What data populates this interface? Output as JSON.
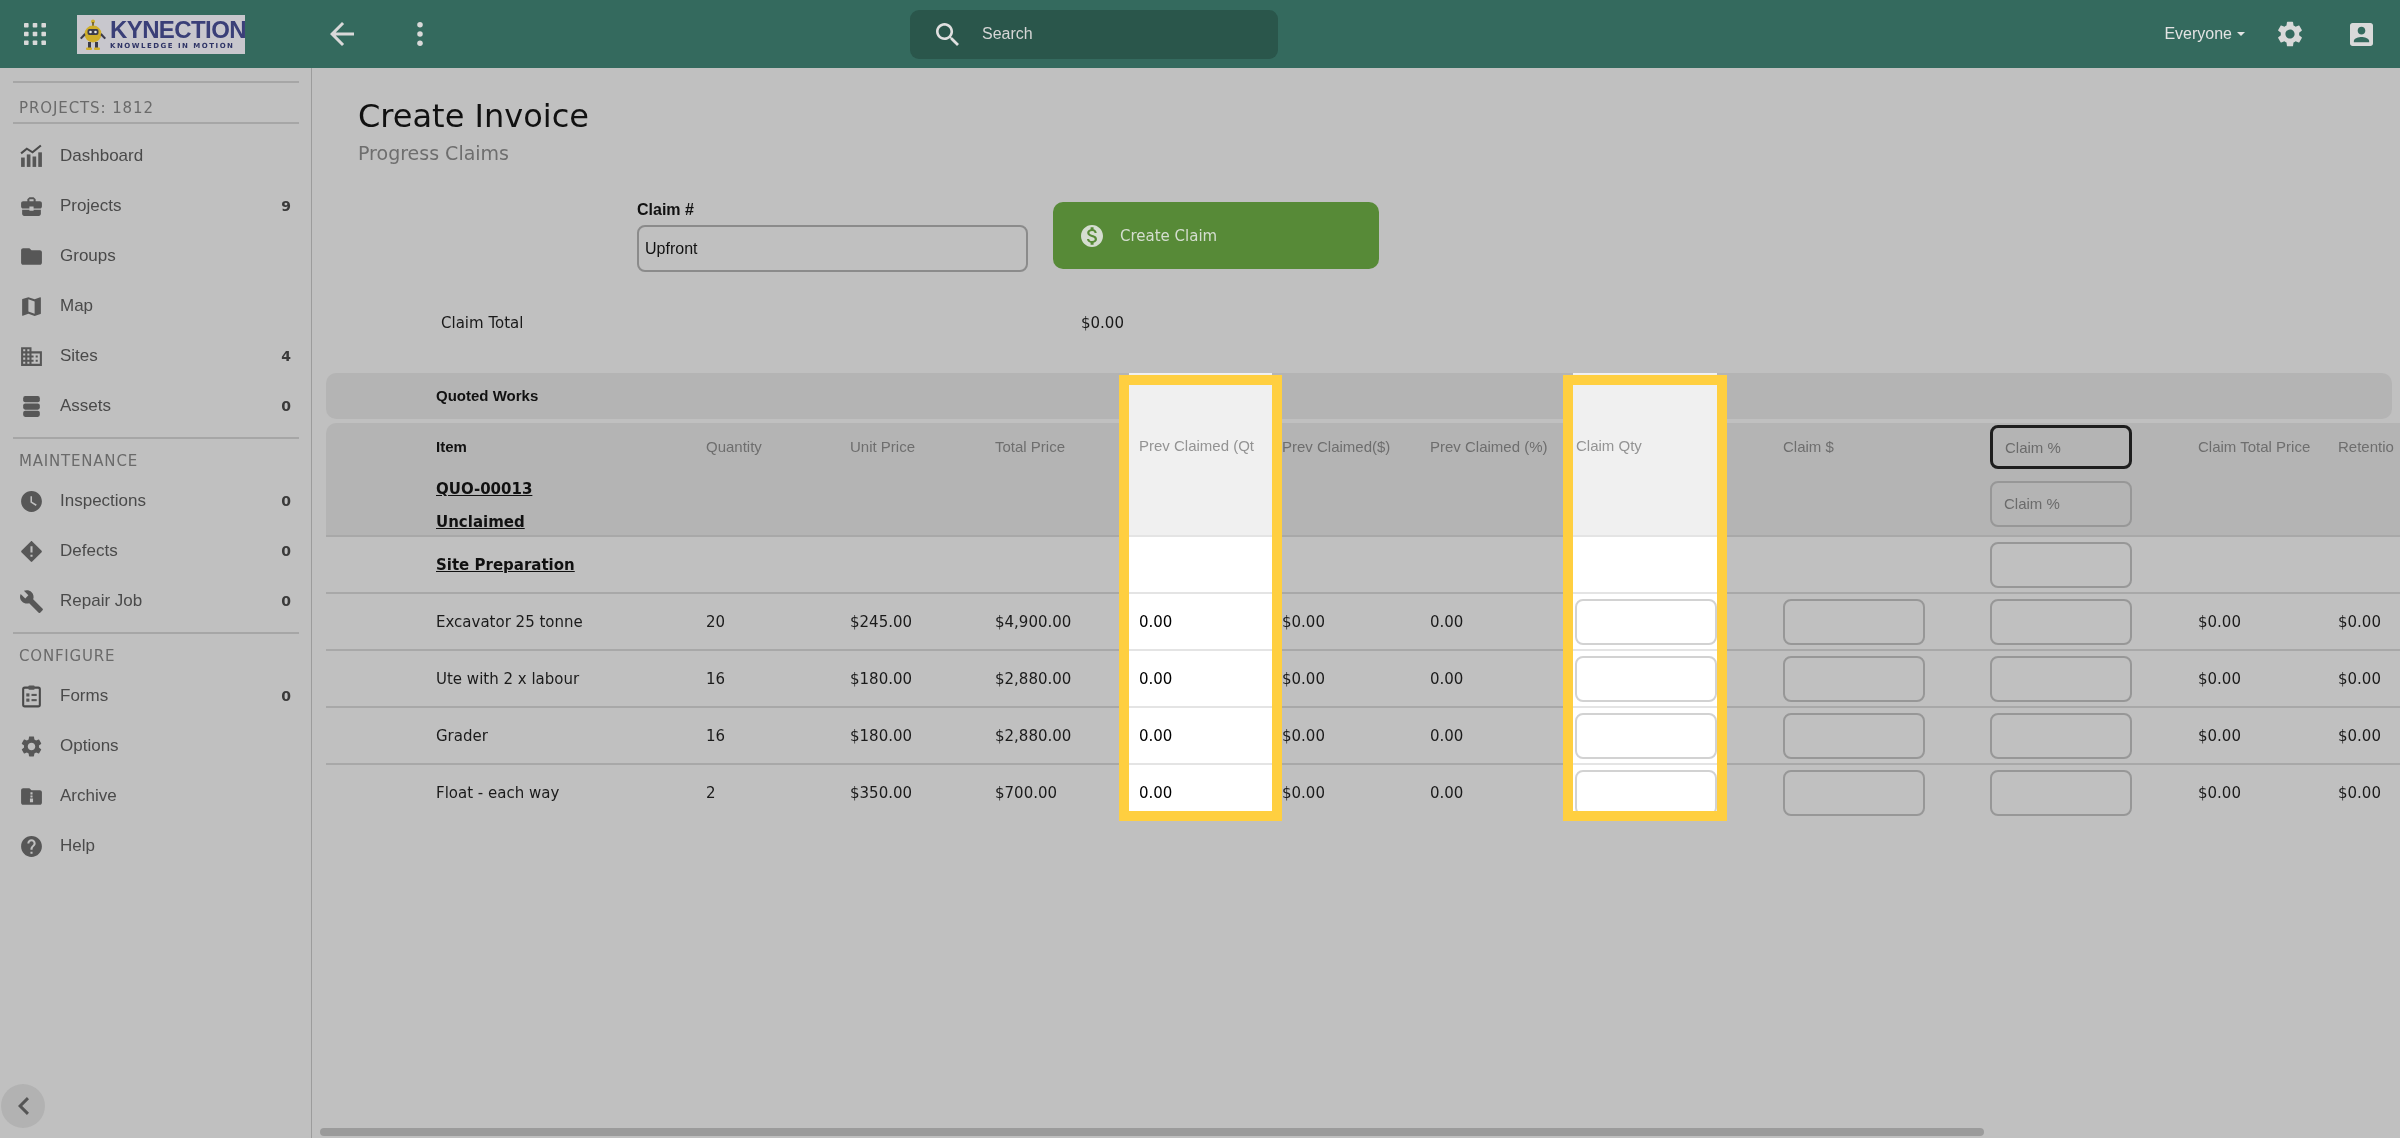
{
  "top_bar": {
    "logo": {
      "name": "KYNECTION",
      "tagline": "KNOWLEDGE IN MOTION"
    },
    "search": {
      "placeholder": "Search"
    },
    "audience_menu": "Everyone"
  },
  "sidebar": {
    "header": "PROJECTS: 1812",
    "sections": [
      {
        "items": [
          {
            "label": "Dashboard"
          },
          {
            "label": "Projects",
            "count": "9"
          },
          {
            "label": "Groups"
          },
          {
            "label": "Map"
          },
          {
            "label": "Sites",
            "count": "4"
          },
          {
            "label": "Assets",
            "count": "0"
          }
        ]
      },
      {
        "title": "MAINTENANCE",
        "items": [
          {
            "label": "Inspections",
            "count": "0"
          },
          {
            "label": "Defects",
            "count": "0"
          },
          {
            "label": "Repair Job",
            "count": "0"
          }
        ]
      },
      {
        "title": "CONFIGURE",
        "items": [
          {
            "label": "Forms",
            "count": "0"
          },
          {
            "label": "Options"
          },
          {
            "label": "Archive"
          },
          {
            "label": "Help"
          }
        ]
      }
    ]
  },
  "page": {
    "title": "Create Invoice",
    "subtitle": "Progress Claims"
  },
  "claim_form": {
    "label": "Claim #",
    "field": {
      "value": "Upfront"
    },
    "button": "Create Claim"
  },
  "claim_total": {
    "label": "Claim Total",
    "value": "$0.00"
  },
  "table": {
    "group_title": "Quoted Works",
    "columns": [
      {
        "label": "Item",
        "kind": "item",
        "highlighted": false
      },
      {
        "label": "Quantity",
        "kind": "text",
        "highlighted": false
      },
      {
        "label": "Unit Price",
        "kind": "text",
        "highlighted": false
      },
      {
        "label": "Total Price",
        "kind": "text",
        "highlighted": false
      },
      {
        "label": "Prev Claimed (Qt",
        "kind": "text",
        "highlighted": true
      },
      {
        "label": "Prev Claimed($)",
        "kind": "text",
        "highlighted": false
      },
      {
        "label": "Prev Claimed (%)",
        "kind": "text",
        "highlighted": false
      },
      {
        "label": "Claim Qty",
        "kind": "input",
        "highlighted": true
      },
      {
        "label": "Claim $",
        "kind": "input",
        "highlighted": false
      },
      {
        "kind": "field",
        "header_field": {
          "placeholder": "Claim %",
          "focused": true
        },
        "highlighted": false
      },
      {
        "label": "Claim Total Price",
        "kind": "text",
        "highlighted": false
      },
      {
        "label": "Retentio",
        "kind": "text",
        "highlighted": false
      }
    ],
    "quote": {
      "number": "QUO-00013",
      "status": "Unclaimed",
      "claim_percent": {
        "placeholder": "Claim %",
        "focused": false
      }
    },
    "sections": [
      {
        "name": "Site Preparation",
        "claim_percent": {
          "focused": false
        },
        "rows": [
          {
            "cells": [
              "Excavator 25 tonne",
              "20",
              "$245.00",
              "$4,900.00",
              "0.00",
              "$0.00",
              "0.00",
              {
                "kind": "field",
                "focused": false
              },
              {
                "kind": "field",
                "focused": false
              },
              {
                "kind": "field",
                "focused": false
              },
              "$0.00",
              "$0.00"
            ]
          },
          {
            "cells": [
              "Ute with 2 x labour",
              "16",
              "$180.00",
              "$2,880.00",
              "0.00",
              "$0.00",
              "0.00",
              {
                "kind": "field",
                "focused": false
              },
              {
                "kind": "field",
                "focused": false
              },
              {
                "kind": "field",
                "focused": false
              },
              "$0.00",
              "$0.00"
            ]
          },
          {
            "cells": [
              "Grader",
              "16",
              "$180.00",
              "$2,880.00",
              "0.00",
              "$0.00",
              "0.00",
              {
                "kind": "field",
                "focused": false
              },
              {
                "kind": "field",
                "focused": false
              },
              {
                "kind": "field",
                "focused": false
              },
              "$0.00",
              "$0.00"
            ]
          },
          {
            "cells": [
              "Float - each way",
              "2",
              "$350.00",
              "$700.00",
              "0.00",
              "$0.00",
              "0.00",
              {
                "kind": "field",
                "focused": false
              },
              {
                "kind": "field",
                "focused": false
              },
              {
                "kind": "field",
                "focused": false
              },
              "$0.00",
              "$0.00"
            ]
          }
        ]
      }
    ]
  }
}
